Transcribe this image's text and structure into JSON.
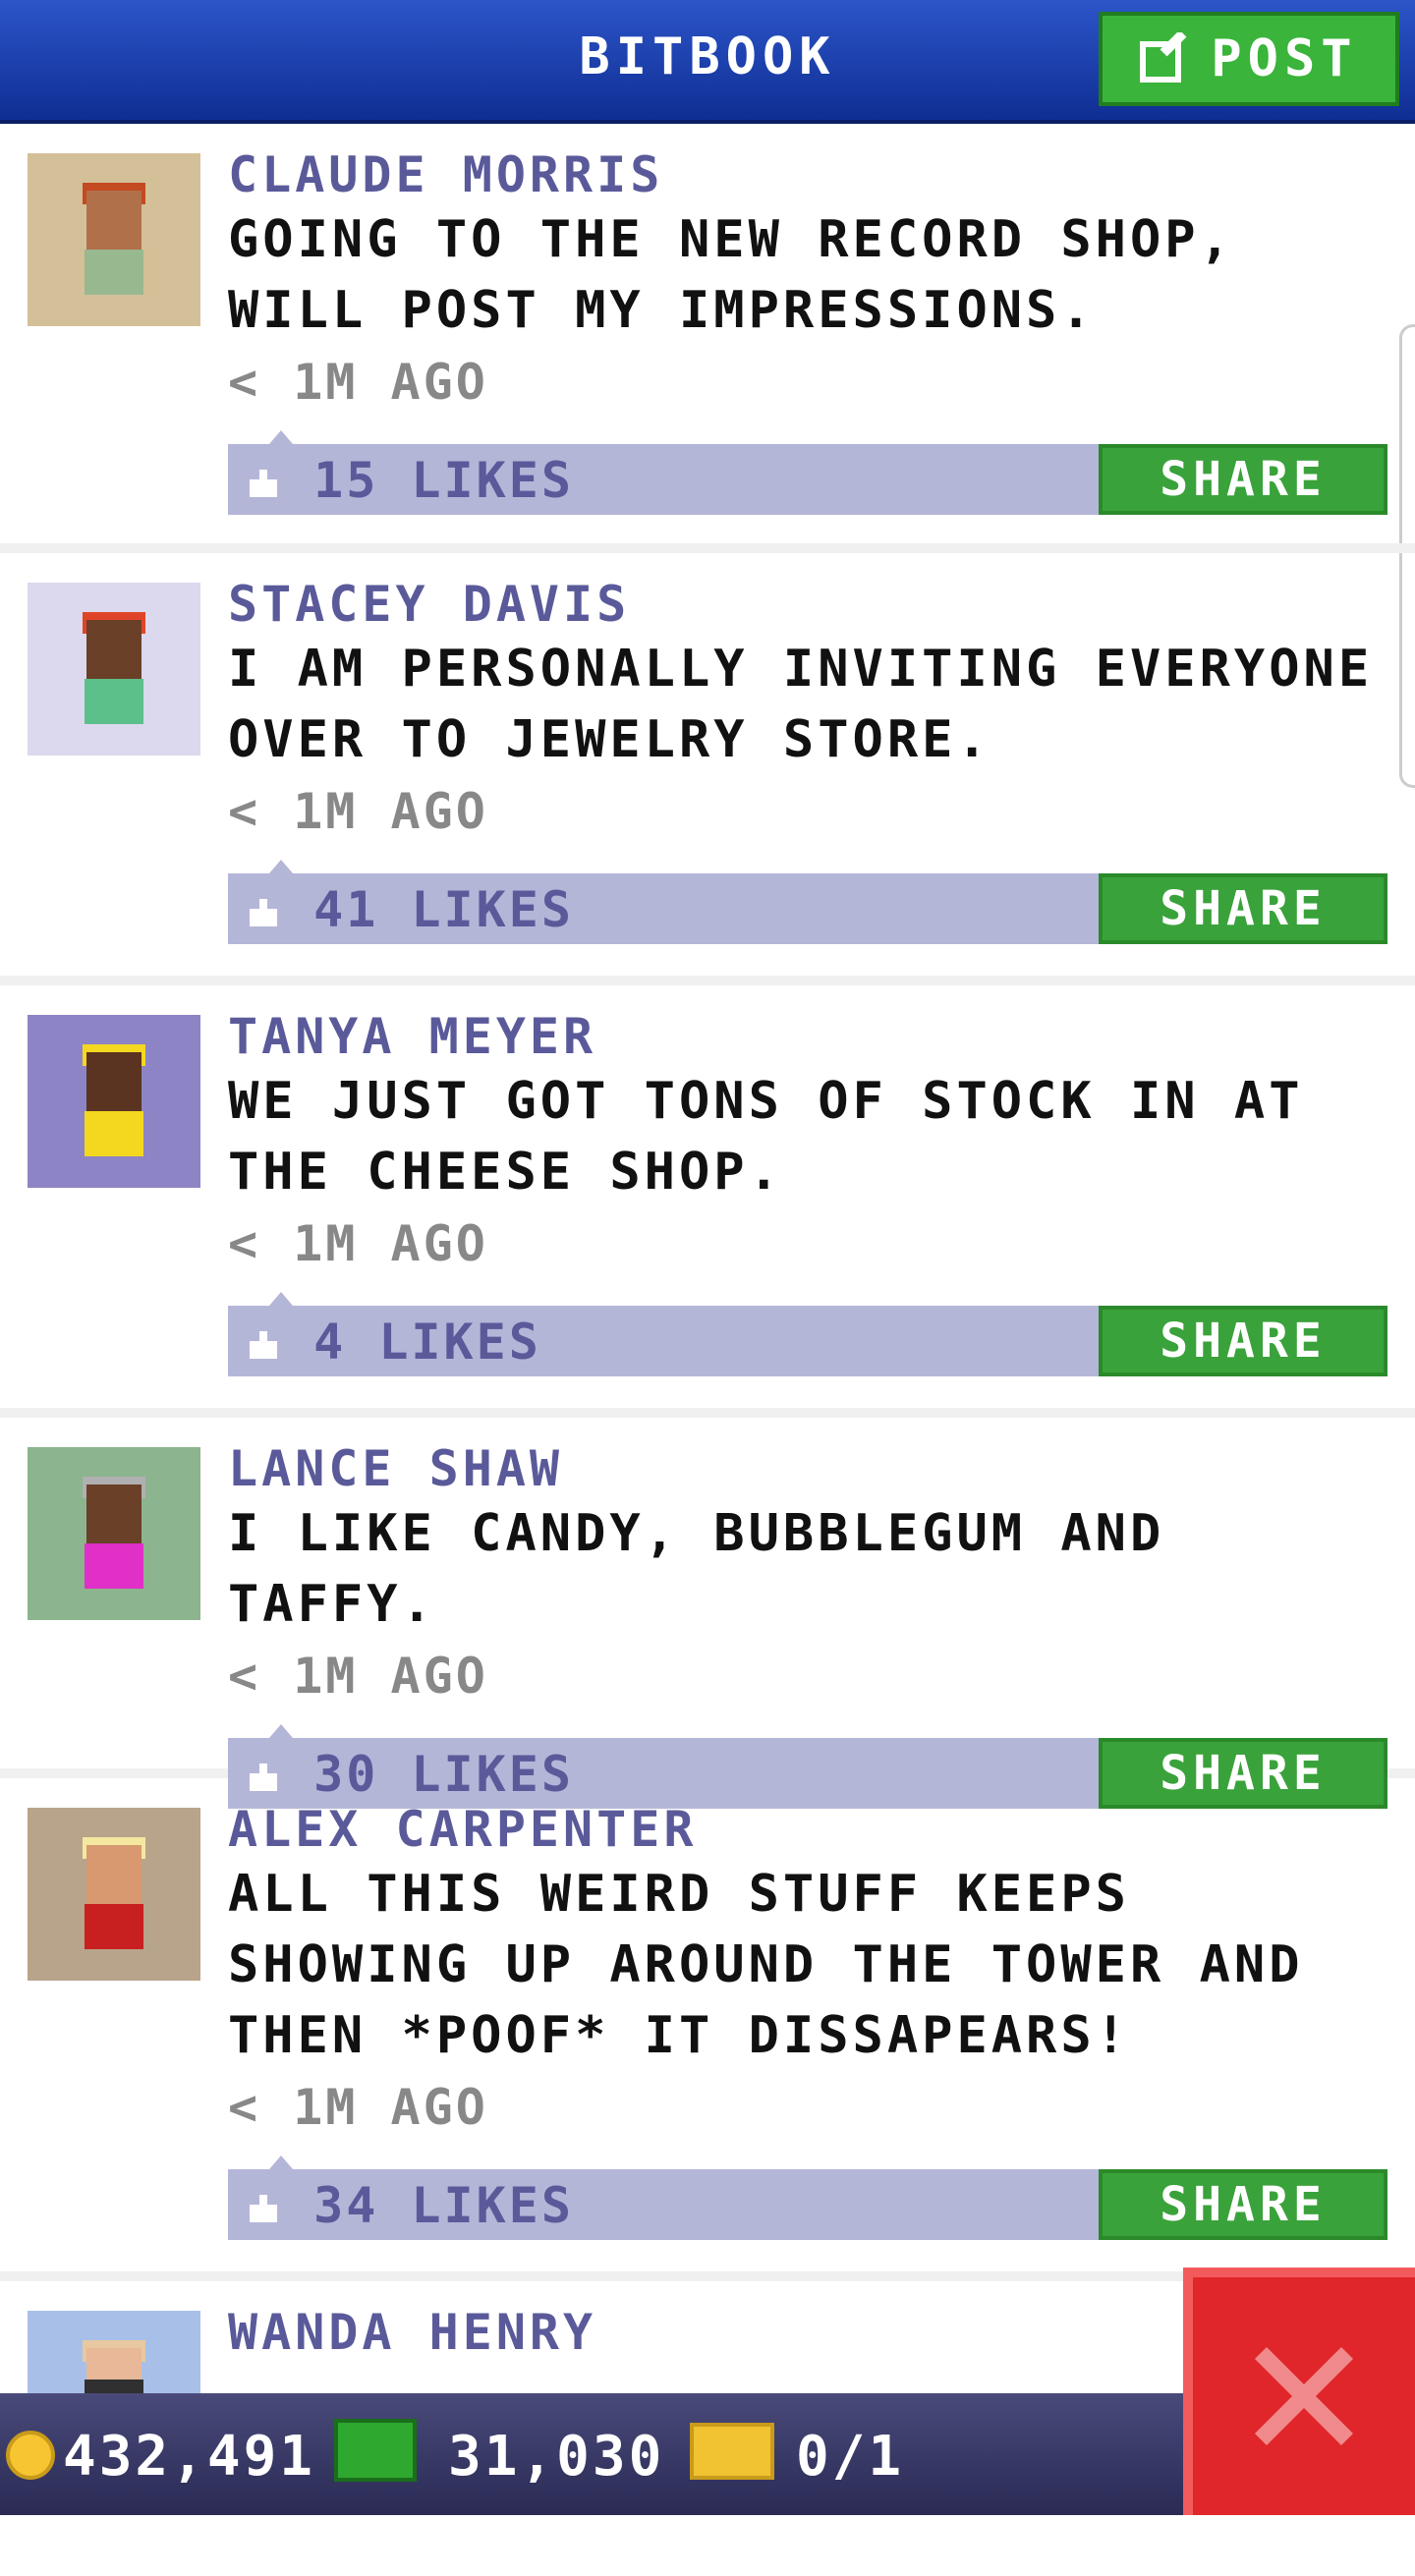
{
  "header": {
    "title": "BITBOOK",
    "post_label": "POST"
  },
  "posts": [
    {
      "name": "CLAUDE MORRIS",
      "message": "GOING TO THE NEW RECORD SHOP, WILL POST MY IMPRESSIONS.",
      "time": "< 1M AGO",
      "likes": "15 LIKES",
      "share": "SHARE",
      "avatar_bg": "#d4c098",
      "hair": "#c44a22",
      "skin": "#b0704a",
      "shirt": "#98b890"
    },
    {
      "name": "STACEY DAVIS",
      "message": "I AM PERSONALLY INVITING EVERYONE OVER TO JEWELRY STORE.",
      "time": "< 1M AGO",
      "likes": "41 LIKES",
      "share": "SHARE",
      "avatar_bg": "#dcd8ee",
      "hair": "#e04428",
      "skin": "#6a4028",
      "shirt": "#5cc08a"
    },
    {
      "name": "TANYA MEYER",
      "message": "WE JUST GOT TONS OF STOCK IN AT THE CHEESE SHOP.",
      "time": "< 1M AGO",
      "likes": "4 LIKES",
      "share": "SHARE",
      "avatar_bg": "#8c84c4",
      "hair": "#f4d820",
      "skin": "#5a3420",
      "shirt": "#f4d820"
    },
    {
      "name": "LANCE SHAW",
      "message": "I LIKE CANDY, BUBBLEGUM AND TAFFY.",
      "time": "< 1M AGO",
      "likes": "30 LIKES",
      "share": "SHARE",
      "avatar_bg": "#8cb48e",
      "hair": "#b0b0b0",
      "skin": "#6a4028",
      "shirt": "#e030c8"
    },
    {
      "name": "ALEX CARPENTER",
      "message": "ALL THIS WEIRD STUFF KEEPS SHOWING UP AROUND THE TOWER AND THEN *POOF* IT DISSAPEARS!",
      "time": "< 1M AGO",
      "likes": "34 LIKES",
      "share": "SHARE",
      "avatar_bg": "#b8a48a",
      "hair": "#f4e8a0",
      "skin": "#d89870",
      "shirt": "#c82020"
    },
    {
      "name": "WANDA HENRY",
      "message": "",
      "time": "",
      "likes": "",
      "share": "",
      "avatar_bg": "#a8c0e8",
      "hair": "#e8c8a0",
      "skin": "#e8b898",
      "shirt": "#303030"
    }
  ],
  "status": {
    "coins": "432,491",
    "bux": "31,030",
    "tickets": "0/1"
  },
  "colors": {
    "header": "#1c3fae",
    "share_green": "#3aa23a",
    "like_bar": "#b4b6d8",
    "close_red": "#e0262a"
  },
  "icons": [
    "edit-icon",
    "like-icon",
    "coin-icon",
    "bux-icon",
    "ticket-icon",
    "close-icon"
  ]
}
